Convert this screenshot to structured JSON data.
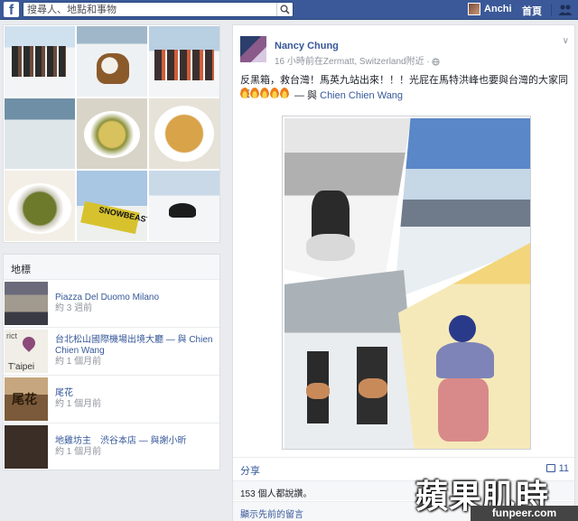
{
  "topbar": {
    "logo": "f",
    "search_placeholder": "搜尋人、地點和事物",
    "user_name": "Anchi",
    "home": "首頁"
  },
  "photos": {
    "thumb_caption": "SNOWBEAST"
  },
  "places": {
    "header": "地標",
    "items": [
      {
        "title": "Piazza Del Duomo Milano",
        "sub": "約 3 週前"
      },
      {
        "title": "台北松山國際機場出境大廳 — 與 Chien Chien Wang",
        "sub": "約 1 個月前",
        "map_label": "T'aipei",
        "map_label2": "rict"
      },
      {
        "title": "尾花",
        "sub": "約 1 個月前",
        "sign": "尾花"
      },
      {
        "title": "地雞坊主　渋谷本店 — 與謝小昕",
        "sub": "約 1 個月前"
      }
    ]
  },
  "post": {
    "author": "Nancy Chung",
    "meta": "16 小時前在Zermatt, Switzerland附近 · ",
    "text": "反黑箱，救台灣！馬英九站出來！！！光屁在馬特洪峰也要與台灣的大家同在",
    "with_prefix": "— 與 ",
    "with_name": "Chien Chien Wang",
    "fire_count": 5,
    "share": "分享",
    "comment_count": "11",
    "likes": "153 個人都說讚。",
    "prev_comments": "顯示先前的留言"
  },
  "watermark": {
    "main": "蘋果肌時",
    "sub": "funpeer.com"
  },
  "colors": {
    "brand": "#3b5998",
    "link": "#365899",
    "background": "#e9ebee"
  }
}
